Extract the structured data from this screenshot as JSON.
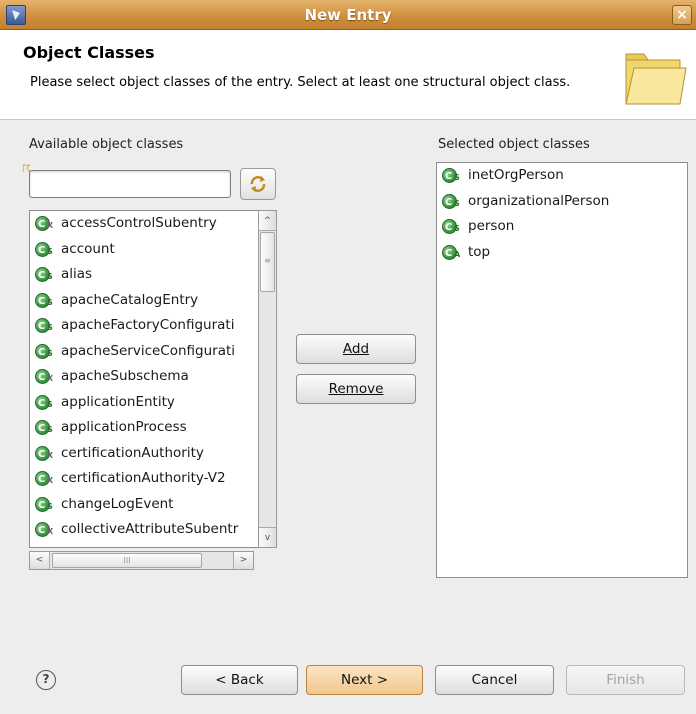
{
  "window": {
    "title": "New Entry",
    "close_glyph": "×"
  },
  "header": {
    "title": "Object Classes",
    "description": "Please select object classes of the entry. Select at least one structural object class."
  },
  "available": {
    "label": "Available object classes",
    "search_value": "",
    "items": [
      {
        "name": "accessControlSubentry",
        "kind": "x"
      },
      {
        "name": "account",
        "kind": "s"
      },
      {
        "name": "alias",
        "kind": "s"
      },
      {
        "name": "apacheCatalogEntry",
        "kind": "s"
      },
      {
        "name": "apacheFactoryConfigurati",
        "kind": "s"
      },
      {
        "name": "apacheServiceConfigurati",
        "kind": "s"
      },
      {
        "name": "apacheSubschema",
        "kind": "x"
      },
      {
        "name": "applicationEntity",
        "kind": "s"
      },
      {
        "name": "applicationProcess",
        "kind": "s"
      },
      {
        "name": "certificationAuthority",
        "kind": "x"
      },
      {
        "name": "certificationAuthority-V2",
        "kind": "x"
      },
      {
        "name": "changeLogEvent",
        "kind": "s"
      },
      {
        "name": "collectiveAttributeSubentr",
        "kind": "x"
      }
    ]
  },
  "buttons": {
    "add": "Add",
    "remove": "Remove"
  },
  "selected": {
    "label": "Selected object classes",
    "items": [
      {
        "name": "inetOrgPerson",
        "kind": "s"
      },
      {
        "name": "organizationalPerson",
        "kind": "s"
      },
      {
        "name": "person",
        "kind": "s"
      },
      {
        "name": "top",
        "kind": "a"
      }
    ]
  },
  "footer": {
    "help": "?",
    "back": "< Back",
    "next": "Next >",
    "cancel": "Cancel",
    "finish": "Finish"
  },
  "icons": {
    "structural": "S",
    "auxiliary": "X",
    "abstract": "A"
  },
  "scroll": {
    "up": "^",
    "down": "v",
    "left": "<",
    "right": ">",
    "thumb": "≡",
    "hthumb": "III"
  }
}
